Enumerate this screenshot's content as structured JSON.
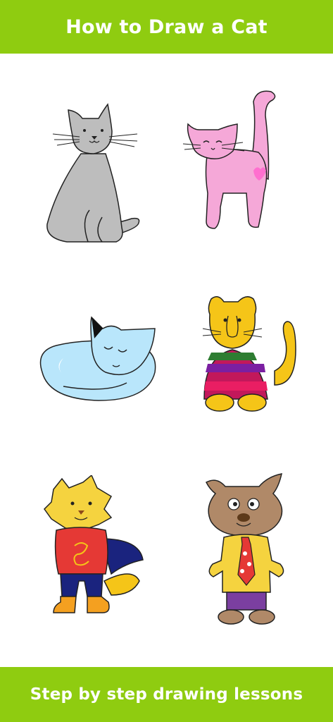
{
  "header": {
    "title": "How to Draw a Cat"
  },
  "footer": {
    "subtitle": "Step by step drawing lessons"
  },
  "colors": {
    "accent": "#8fcc10",
    "background": "#ffffff",
    "bar_text": "#ffffff"
  },
  "gallery": {
    "items": [
      {
        "icon": "gray-sitting-cat-icon"
      },
      {
        "icon": "pink-cat-with-heart-icon"
      },
      {
        "icon": "sleeping-blue-cat-icon"
      },
      {
        "icon": "yellow-cat-in-sweater-icon"
      },
      {
        "icon": "superhero-cat-icon"
      },
      {
        "icon": "brown-cat-with-tie-icon"
      }
    ]
  }
}
